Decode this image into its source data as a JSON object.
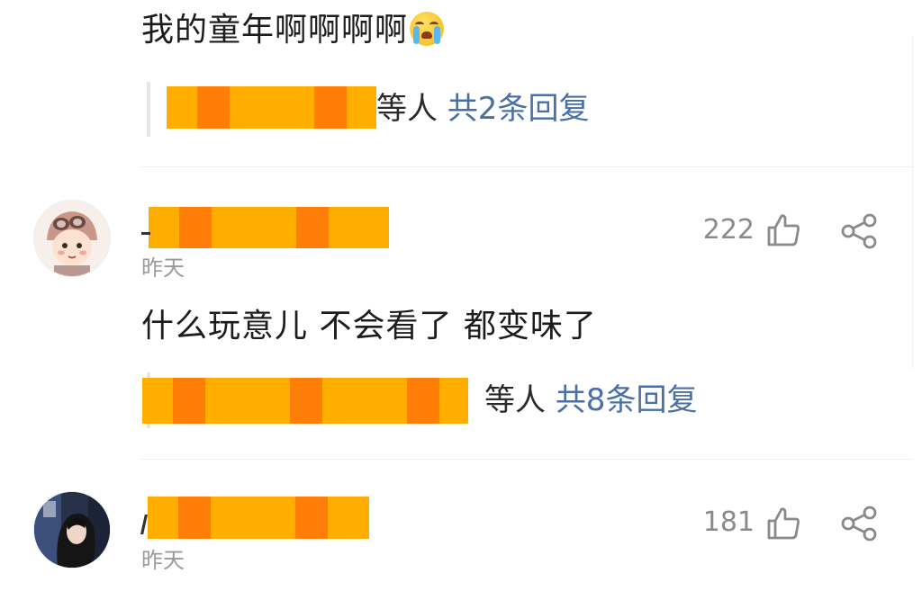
{
  "comments": [
    {
      "text": "我的童年啊啊啊啊",
      "emoji": "crying-face-emoji",
      "replies": {
        "suffix": "等人",
        "count_label": "共2条回复"
      }
    },
    {
      "time": "昨天",
      "likes": "222",
      "text": "什么玩意儿 不会看了 都变味了",
      "replies": {
        "suffix": "等人",
        "count_label": "共8条回复"
      }
    },
    {
      "time": "昨天",
      "likes": "181"
    }
  ],
  "icons": {
    "like": "thumbs-up-icon",
    "share": "share-icon"
  },
  "colors": {
    "redaction": "#ffae00",
    "reply_count": "#4a6fa5",
    "meta_gray": "#9a9a9a"
  }
}
